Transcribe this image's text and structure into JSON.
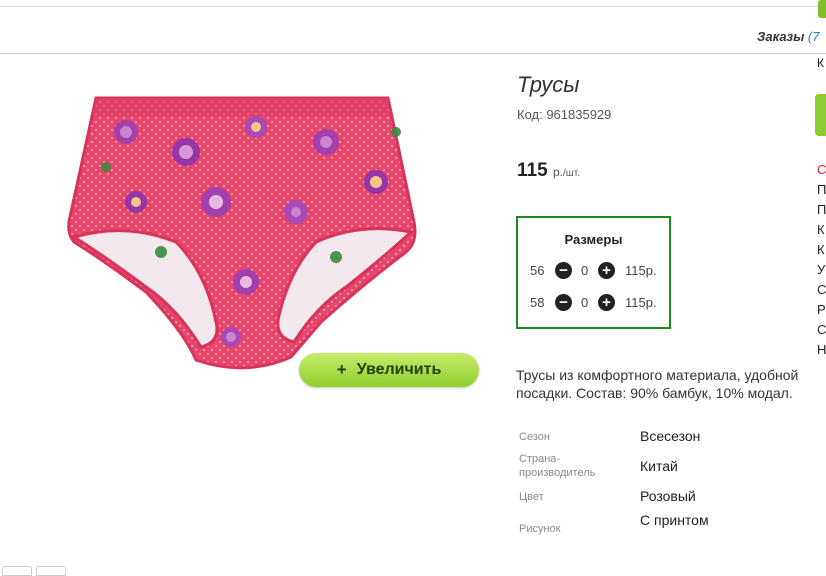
{
  "header": {
    "orders_label": "Заказы",
    "orders_count": "(7"
  },
  "product": {
    "title": "Трусы",
    "code": "Код: 961835929",
    "price_value": "115",
    "price_unit": "р.",
    "price_per": "/шт.",
    "zoom_label": "Увеличить",
    "description": "Трусы из комфортного материала, удобной посадки. Состав: 90% бамбук, 10% модал."
  },
  "sizes": {
    "title": "Размеры",
    "rows": [
      {
        "size": "56",
        "qty": "0",
        "price": "115р."
      },
      {
        "size": "58",
        "qty": "0",
        "price": "115р."
      }
    ]
  },
  "attributes": [
    {
      "label": "Сезон",
      "value": "Всесезон"
    },
    {
      "label": "Страна-производитель",
      "value": "Китай"
    },
    {
      "label": "Цвет",
      "value": "Розовый"
    },
    {
      "label": "Рисунок",
      "value": "С принтом"
    }
  ],
  "right_edge_letters": [
    "К",
    "С",
    "П",
    "П",
    "К",
    "К",
    "У",
    "С",
    "Р",
    "С",
    "Н"
  ],
  "colors": {
    "accent_green": "#8fcf2c",
    "border_green": "#1f8a1f",
    "fabric_pink": "#e8456a"
  }
}
